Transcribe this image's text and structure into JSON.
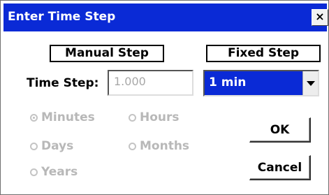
{
  "window": {
    "title": "Enter Time Step",
    "close_label": "×"
  },
  "modes": {
    "manual_label": "Manual Step",
    "fixed_label": "Fixed Step"
  },
  "time_step": {
    "label": "Time Step:",
    "value": "1.000"
  },
  "fixed_step": {
    "selected": "1 min"
  },
  "units": [
    {
      "label": "Minutes",
      "checked": true
    },
    {
      "label": "Hours",
      "checked": false
    },
    {
      "label": "Days",
      "checked": false
    },
    {
      "label": "Months",
      "checked": false
    },
    {
      "label": "Years",
      "checked": false
    }
  ],
  "buttons": {
    "ok": "OK",
    "cancel": "Cancel"
  }
}
